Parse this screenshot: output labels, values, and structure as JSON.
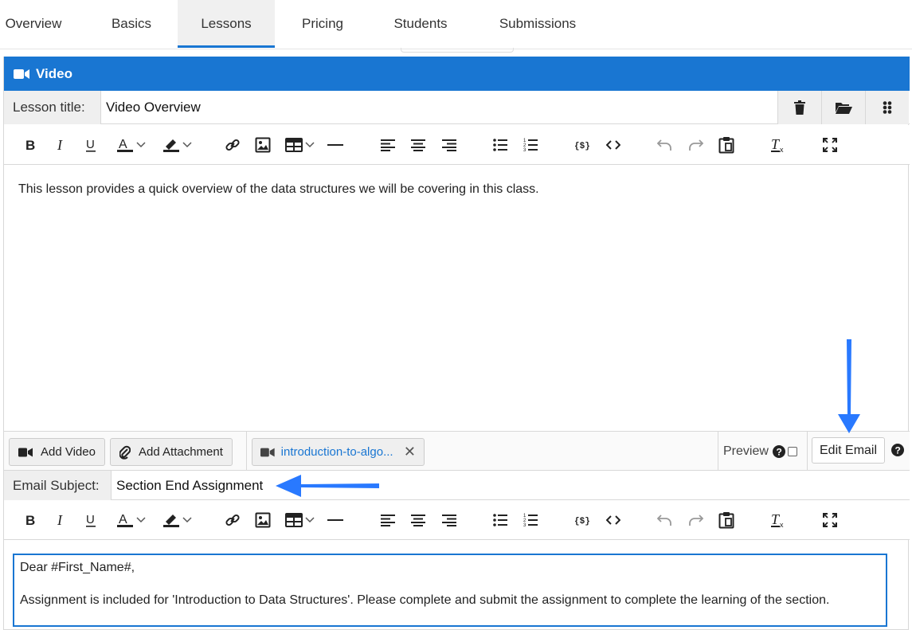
{
  "tabs": [
    {
      "label": "Overview"
    },
    {
      "label": "Basics"
    },
    {
      "label": "Lessons"
    },
    {
      "label": "Pricing"
    },
    {
      "label": "Students"
    },
    {
      "label": "Submissions"
    }
  ],
  "active_tab": "Lessons",
  "panel": {
    "title": "Video",
    "title_icon": "video-camera-icon",
    "header_color": "#1976d2"
  },
  "lesson": {
    "label": "Lesson title:",
    "value": "Video Overview",
    "actions": [
      "trash-icon",
      "folder-open-icon",
      "drag-handle-icon"
    ]
  },
  "toolbar_items": [
    "bold",
    "italic",
    "underline",
    "font-color",
    "highlight-color",
    "link",
    "image",
    "table",
    "horizontal-rule",
    "align-left",
    "align-center",
    "align-right",
    "bulleted-list",
    "numbered-list",
    "variables",
    "source-code",
    "undo",
    "redo",
    "paste",
    "clear-formatting",
    "fullscreen"
  ],
  "editor1": {
    "text": "This lesson provides a quick overview of the data structures we will be covering in this class."
  },
  "actions": {
    "add_video": "Add Video",
    "add_attachment": "Add Attachment",
    "file_name": "introduction-to-algo...",
    "preview_label": "Preview",
    "edit_email": "Edit Email"
  },
  "email": {
    "subject_label": "Email Subject:",
    "subject_value": "Section End Assignment",
    "greeting": "Dear #First_Name#,",
    "body": "Assignment is included for 'Introduction to Data Structures'. Please complete and submit the assignment to complete the learning of the section."
  },
  "colors": {
    "accent": "#1976d2",
    "annotation_arrow": "#2979ff"
  }
}
